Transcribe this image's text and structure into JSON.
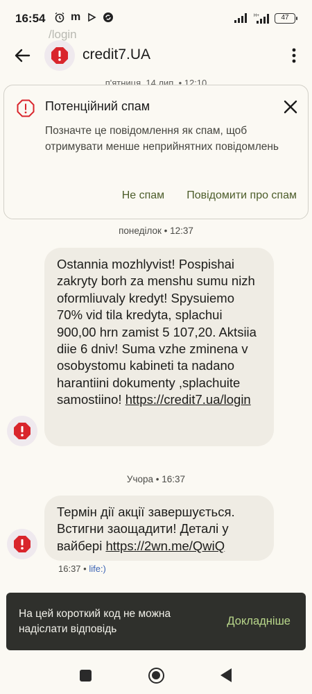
{
  "status_bar": {
    "time": "16:54",
    "battery": "47"
  },
  "ghost_text": "/login",
  "app_bar": {
    "title": "credit7.UA"
  },
  "hidden_date": "п'ятниця, 14 лип. • 12:10",
  "spam_card": {
    "title": "Потенційний спам",
    "description": "Позначте це повідомлення як спам, щоб отримувати менше неприйнятних повідомлень",
    "not_spam": "Не спам",
    "report_spam": "Повідомити про спам"
  },
  "messages": [
    {
      "day_label": "понеділок • 12:37",
      "text": "Ostannia mozhlyvist! Pospishai zakryty borh za menshu sumu nizh oformliuvaly kredyt! Spysuiemo 70% vid tila kredyta, splachui 900,00 hrn zamist 5 107,20. Aktsiia diie 6 dniv! Suma vzhe zminena v osobystomu kabineti ta nadano harantiini dokumenty ,splachuite samostiino!",
      "link": "https://credit7.ua/login"
    },
    {
      "day_label": "Учора • 16:37",
      "text": "Термін дії акції завершується. Встигни заощадити! Деталі у вайбері",
      "link": "https://2wn.me/QwiQ"
    }
  ],
  "meta": {
    "time": "16:37",
    "carrier": "life:)"
  },
  "snackbar": {
    "message": "На цей короткий код не можна надіслати відповідь",
    "action": "Докладніше"
  },
  "colors": {
    "background": "#fbf9f3",
    "bubble": "#efece4",
    "accent_green": "#4c5d2a",
    "warning_red": "#d9252c"
  }
}
